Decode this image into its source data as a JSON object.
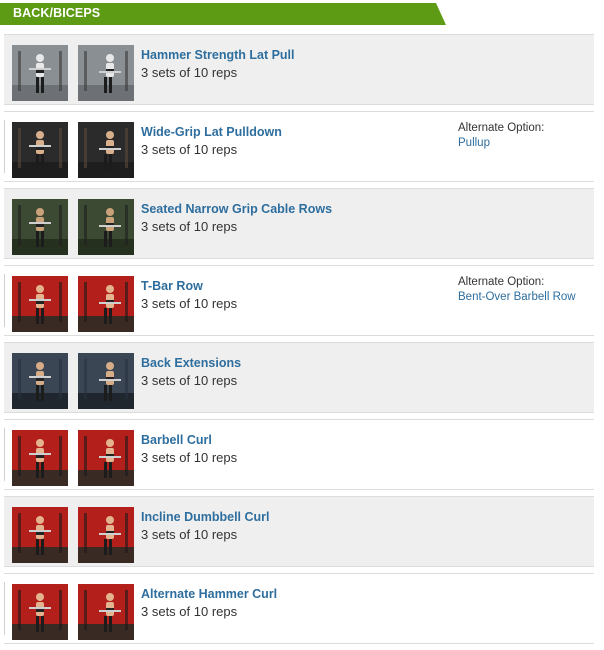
{
  "section": {
    "title": "BACK/BICEPS",
    "header_color": "#5e9b14"
  },
  "colors": {
    "link": "#2e6e9e",
    "text": "#333333",
    "row_shaded": "#efefef"
  },
  "exercises": [
    {
      "name": "Hammer Strength Lat Pull",
      "sets": "3 sets of 10 reps",
      "shaded": true,
      "scene": "gym-gray",
      "alternate": null
    },
    {
      "name": "Wide-Grip Lat Pulldown",
      "sets": "3 sets of 10 reps",
      "shaded": false,
      "scene": "gym-dark",
      "alternate": {
        "label": "Alternate Option:",
        "option": "Pullup"
      }
    },
    {
      "name": "Seated Narrow Grip Cable Rows",
      "sets": "3 sets of 10 reps",
      "shaded": true,
      "scene": "gym-green",
      "alternate": null
    },
    {
      "name": "T-Bar Row",
      "sets": "3 sets of 10 reps",
      "shaded": false,
      "scene": "studio-red",
      "alternate": {
        "label": "Alternate Option:",
        "option": "Bent-Over Barbell Row"
      }
    },
    {
      "name": "Back Extensions",
      "sets": "3 sets of 10 reps",
      "shaded": true,
      "scene": "gym-blue",
      "alternate": null
    },
    {
      "name": "Barbell Curl",
      "sets": "3 sets of 10 reps",
      "shaded": false,
      "scene": "studio-red",
      "alternate": null
    },
    {
      "name": "Incline Dumbbell Curl",
      "sets": "3 sets of 10 reps",
      "shaded": true,
      "scene": "studio-red",
      "alternate": null
    },
    {
      "name": "Alternate Hammer Curl",
      "sets": "3 sets of 10 reps",
      "shaded": false,
      "scene": "studio-red",
      "alternate": null
    }
  ]
}
